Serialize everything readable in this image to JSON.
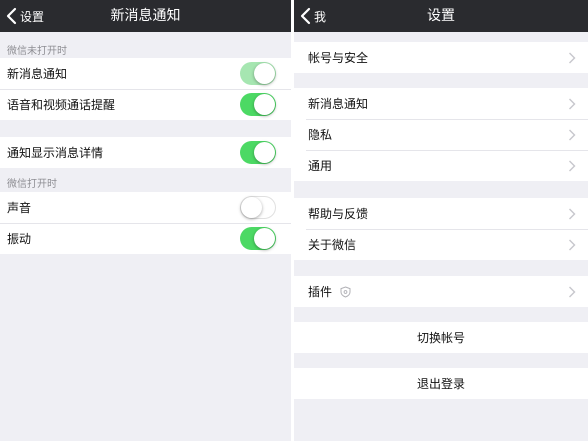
{
  "left": {
    "nav": {
      "back_label": "设置",
      "title": "新消息通知"
    },
    "sections": [
      {
        "label": "微信未打开时",
        "rows": [
          {
            "label": "新消息通知",
            "toggle": "on-disabled"
          },
          {
            "label": "语音和视频通话提醒",
            "toggle": "on"
          }
        ]
      },
      {
        "label": "",
        "rows": [
          {
            "label": "通知显示消息详情",
            "toggle": "on"
          }
        ]
      },
      {
        "label": "微信打开时",
        "rows": [
          {
            "label": "声音",
            "toggle": "off"
          },
          {
            "label": "振动",
            "toggle": "on"
          }
        ]
      }
    ]
  },
  "right": {
    "nav": {
      "back_label": "我",
      "title": "设置"
    },
    "groups": [
      {
        "rows": [
          {
            "label": "帐号与安全"
          }
        ]
      },
      {
        "rows": [
          {
            "label": "新消息通知"
          },
          {
            "label": "隐私"
          },
          {
            "label": "通用"
          }
        ]
      },
      {
        "rows": [
          {
            "label": "帮助与反馈"
          },
          {
            "label": "关于微信"
          }
        ]
      },
      {
        "rows": [
          {
            "label": "插件",
            "icon": "shield-icon"
          }
        ]
      },
      {
        "rows": [
          {
            "label": "切换帐号"
          }
        ]
      },
      {
        "rows": [
          {
            "label": "退出登录"
          }
        ]
      }
    ]
  },
  "colors": {
    "nav_bg": "#2a2b2f",
    "toggle_on": "#4cd964",
    "toggle_on_disabled": "#a6e6b1",
    "page_bg": "#efeff4"
  }
}
